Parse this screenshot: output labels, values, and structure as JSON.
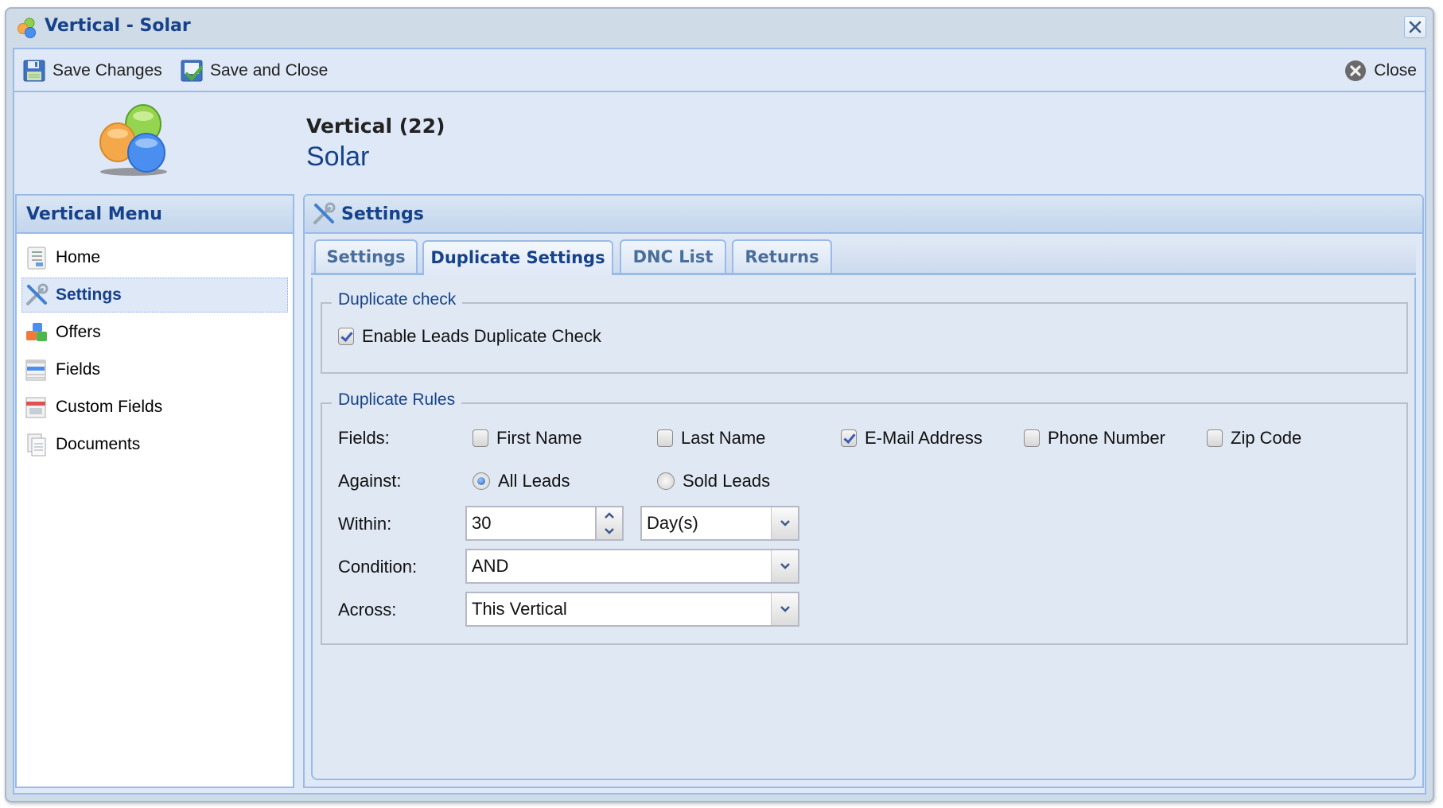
{
  "window": {
    "title": "Vertical - Solar",
    "close_icon": "close-x-icon"
  },
  "toolbar": {
    "save_changes": "Save Changes",
    "save_and_close": "Save and Close",
    "close": "Close"
  },
  "header": {
    "subtitle": "Vertical (22)",
    "title": "Solar"
  },
  "sidebar": {
    "title": "Vertical Menu",
    "items": [
      {
        "label": "Home",
        "icon": "home-document-icon",
        "active": false
      },
      {
        "label": "Settings",
        "icon": "settings-tools-icon",
        "active": true
      },
      {
        "label": "Offers",
        "icon": "offers-cubes-icon",
        "active": false
      },
      {
        "label": "Fields",
        "icon": "fields-list-icon",
        "active": false
      },
      {
        "label": "Custom Fields",
        "icon": "custom-fields-icon",
        "active": false
      },
      {
        "label": "Documents",
        "icon": "documents-icon",
        "active": false
      }
    ]
  },
  "main": {
    "title": "Settings",
    "tabs": [
      {
        "label": "Settings",
        "active": false
      },
      {
        "label": "Duplicate Settings",
        "active": true
      },
      {
        "label": "DNC List",
        "active": false
      },
      {
        "label": "Returns",
        "active": false
      }
    ],
    "duplicate_check": {
      "legend": "Duplicate check",
      "enable_label": "Enable Leads Duplicate Check",
      "enable_checked": true
    },
    "duplicate_rules": {
      "legend": "Duplicate Rules",
      "fields_label": "Fields:",
      "fields": [
        {
          "label": "First Name",
          "checked": false
        },
        {
          "label": "Last Name",
          "checked": false
        },
        {
          "label": "E-Mail Address",
          "checked": true
        },
        {
          "label": "Phone Number",
          "checked": false
        },
        {
          "label": "Zip Code",
          "checked": false
        }
      ],
      "against_label": "Against:",
      "against_options": [
        {
          "label": "All Leads",
          "selected": true
        },
        {
          "label": "Sold Leads",
          "selected": false
        }
      ],
      "within_label": "Within:",
      "within_value": "30",
      "within_unit": "Day(s)",
      "condition_label": "Condition:",
      "condition_value": "AND",
      "across_label": "Across:",
      "across_value": "This Vertical"
    }
  }
}
